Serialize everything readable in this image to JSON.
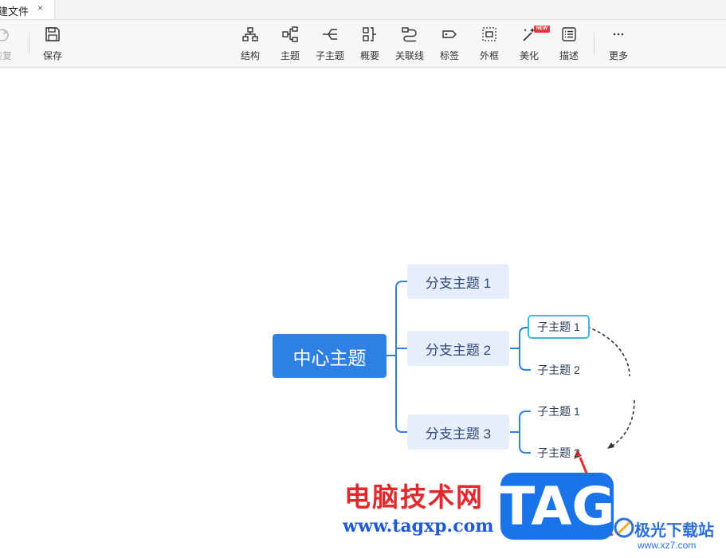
{
  "tab": {
    "title": "建文件",
    "close": "×"
  },
  "toolbar": {
    "redo_label": "恢复",
    "save_label": "保存",
    "items": [
      {
        "icon": "structure-icon",
        "label": "结构"
      },
      {
        "icon": "topic-icon",
        "label": "主题"
      },
      {
        "icon": "subtopic-icon",
        "label": "子主题"
      },
      {
        "icon": "summary-icon",
        "label": "概要"
      },
      {
        "icon": "relationship-icon",
        "label": "关联线"
      },
      {
        "icon": "label-icon",
        "label": "标签"
      },
      {
        "icon": "boundary-icon",
        "label": "外框"
      },
      {
        "icon": "beautify-icon",
        "label": "美化",
        "badge": "NEW"
      },
      {
        "icon": "description-icon",
        "label": "描述"
      },
      {
        "icon": "more-icon",
        "label": "更多"
      }
    ]
  },
  "mindmap": {
    "central": "中心主题",
    "branches": [
      {
        "label": "分支主题 1",
        "children": []
      },
      {
        "label": "分支主题 2",
        "children": [
          "子主题 1",
          "子主题 2"
        ]
      },
      {
        "label": "分支主题 3",
        "children": [
          "子主题 1",
          "子主题 2"
        ]
      }
    ],
    "colors": {
      "central": "#2f80e4",
      "branch_bg": "#e6edfb",
      "line": "#2f80e4",
      "selected_border": "#3fb7e6"
    }
  },
  "watermark": {
    "site_name": "电脑技术网",
    "site_url": "www.tagxp.com",
    "tag": "TAG",
    "logo_name": "极光下载站",
    "logo_url": "www.xz7.com"
  }
}
